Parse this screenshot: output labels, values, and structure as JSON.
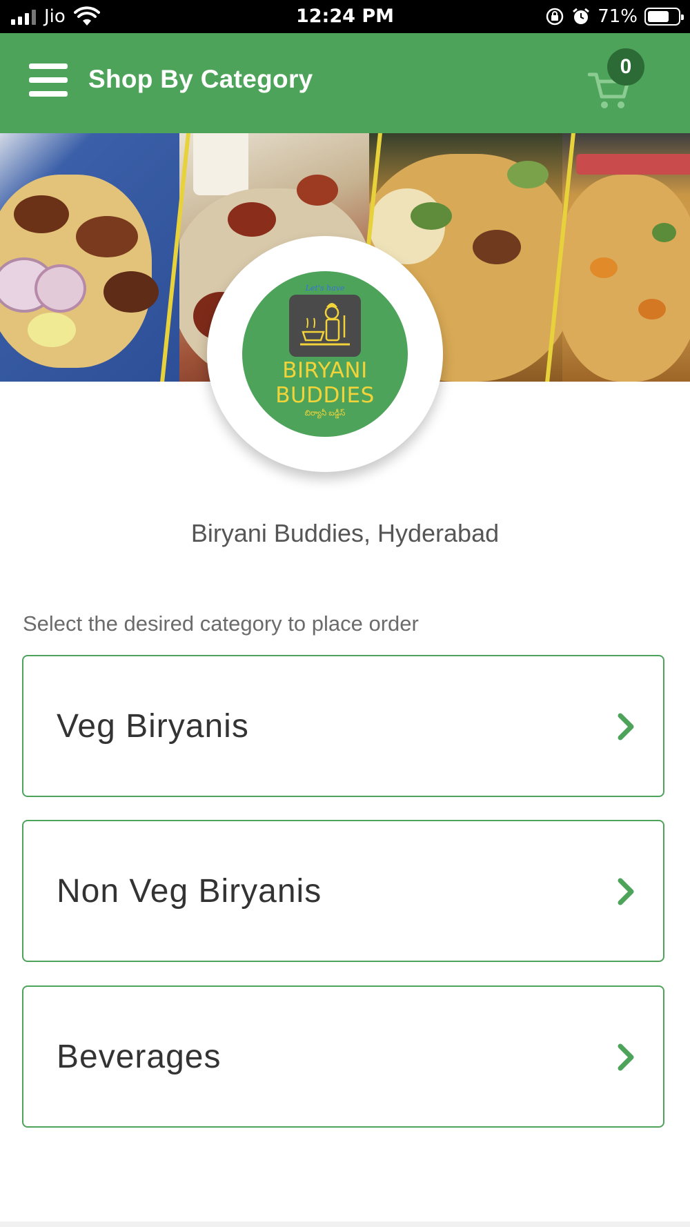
{
  "status_bar": {
    "carrier": "Jio",
    "time": "12:24 PM",
    "battery_percent": "71%",
    "battery_level": 0.71,
    "icons": [
      "signal-icon",
      "wifi-icon",
      "orientation-lock-icon",
      "alarm-icon",
      "battery-icon"
    ]
  },
  "app_bar": {
    "title": "Shop By Category",
    "menu_icon": "hamburger-menu-icon",
    "cart_icon": "shopping-cart-icon",
    "cart_count": "0",
    "color": "#4ea35a"
  },
  "store": {
    "logo": {
      "tagline": "Let's have",
      "line1": "BIRYANI",
      "line2": "BUDDIES",
      "script": "బిర్యానీ బడ్డీస్"
    },
    "name": "Biryani Buddies, Hyderabad"
  },
  "instruction": "Select the desired category to place order",
  "categories": [
    {
      "label": "Veg Biryanis",
      "icon": "chevron-right-icon"
    },
    {
      "label": "Non Veg Biryanis",
      "icon": "chevron-right-icon"
    },
    {
      "label": "Beverages",
      "icon": "chevron-right-icon"
    }
  ],
  "colors": {
    "accent": "#4ea35a",
    "badge": "#2c6b35",
    "logo_text": "#f2d43a"
  }
}
